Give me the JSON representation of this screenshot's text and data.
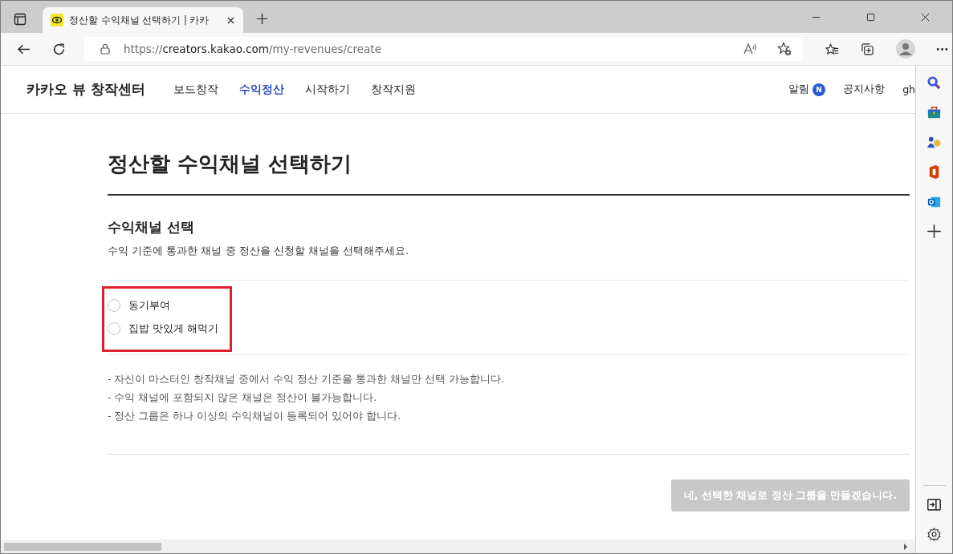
{
  "browser": {
    "tab_title": "정산할 수익채널 선택하기 | 카카",
    "url": {
      "scheme": "https://",
      "host": "creators.kakao.com",
      "path": "/my-revenues/create"
    }
  },
  "site": {
    "logo": "카카오 뷰 창작센터",
    "nav": [
      {
        "label": "보드창작",
        "selected": false
      },
      {
        "label": "수익정산",
        "selected": true
      },
      {
        "label": "시작하기",
        "selected": false
      },
      {
        "label": "창작지원",
        "selected": false
      }
    ],
    "alerts": {
      "label": "알림",
      "badge": "N"
    },
    "notices": "공지사항",
    "account": "gh"
  },
  "page": {
    "title": "정산할 수익채널 선택하기",
    "section_title": "수익채널 선택",
    "description": "수익 기준에 통과한 채널 중 정산을 신청할 채널을 선택해주세요.",
    "channels": [
      {
        "label": "동기부여",
        "selected": false
      },
      {
        "label": "집밥 맛있게 해먹기",
        "selected": false
      }
    ],
    "notes": [
      "- 자신이 마스터인 창작채널 중에서 수익 정산 기준을 통과한 채널만 선택 가능합니다.",
      "- 수익 채널에 포함되지 않은 채널은 정산이 불가능합니다.",
      "- 정산 그룹은 하나 이상의 수익채널이 등록되어 있어야 합니다."
    ],
    "submit": {
      "label": "네, 선택한 채널로 정산 그룹을 만들겠습니다.",
      "disabled": true
    }
  }
}
